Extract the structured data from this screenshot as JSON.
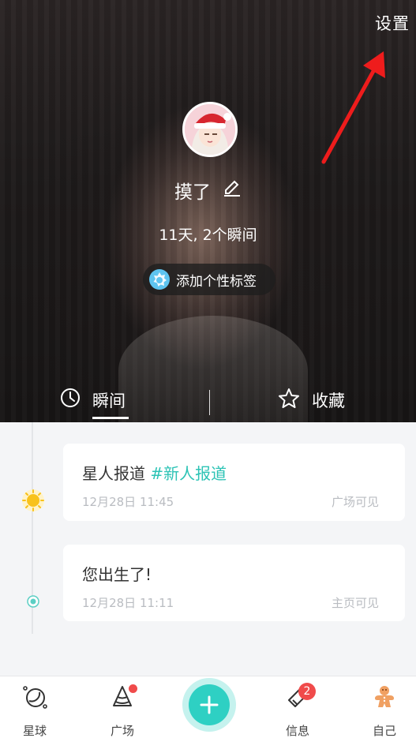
{
  "header": {
    "settings_label": "设置"
  },
  "profile": {
    "username": "摸了",
    "stats": "11天, 2个瞬间",
    "tag_button_label": "添加个性标签"
  },
  "tabs": [
    {
      "label": "瞬间",
      "active": true
    },
    {
      "label": "收藏",
      "active": false
    }
  ],
  "moments": [
    {
      "text": "星人报道 ",
      "hashtag": "#新人报道",
      "time": "12月28日 11:45",
      "visibility": "广场可见",
      "marker": "sun-icon"
    },
    {
      "text": "您出生了!",
      "hashtag": "",
      "time": "12月28日 11:11",
      "visibility": "主页可见",
      "marker": "dot-icon"
    }
  ],
  "bottom_nav": {
    "items": [
      {
        "label": "星球",
        "icon": "planet-icon"
      },
      {
        "label": "广场",
        "icon": "cone-icon",
        "has_dot": true
      },
      {
        "label": "信息",
        "icon": "message-icon",
        "badge": "2"
      },
      {
        "label": "自己",
        "icon": "gingerbread-icon"
      }
    ],
    "fab_icon": "plus-icon"
  },
  "colors": {
    "accent": "#2ed0c3",
    "hashtag": "#2cc3b5",
    "badge": "#f04b4b",
    "annotation_arrow": "#ee1c1c"
  }
}
